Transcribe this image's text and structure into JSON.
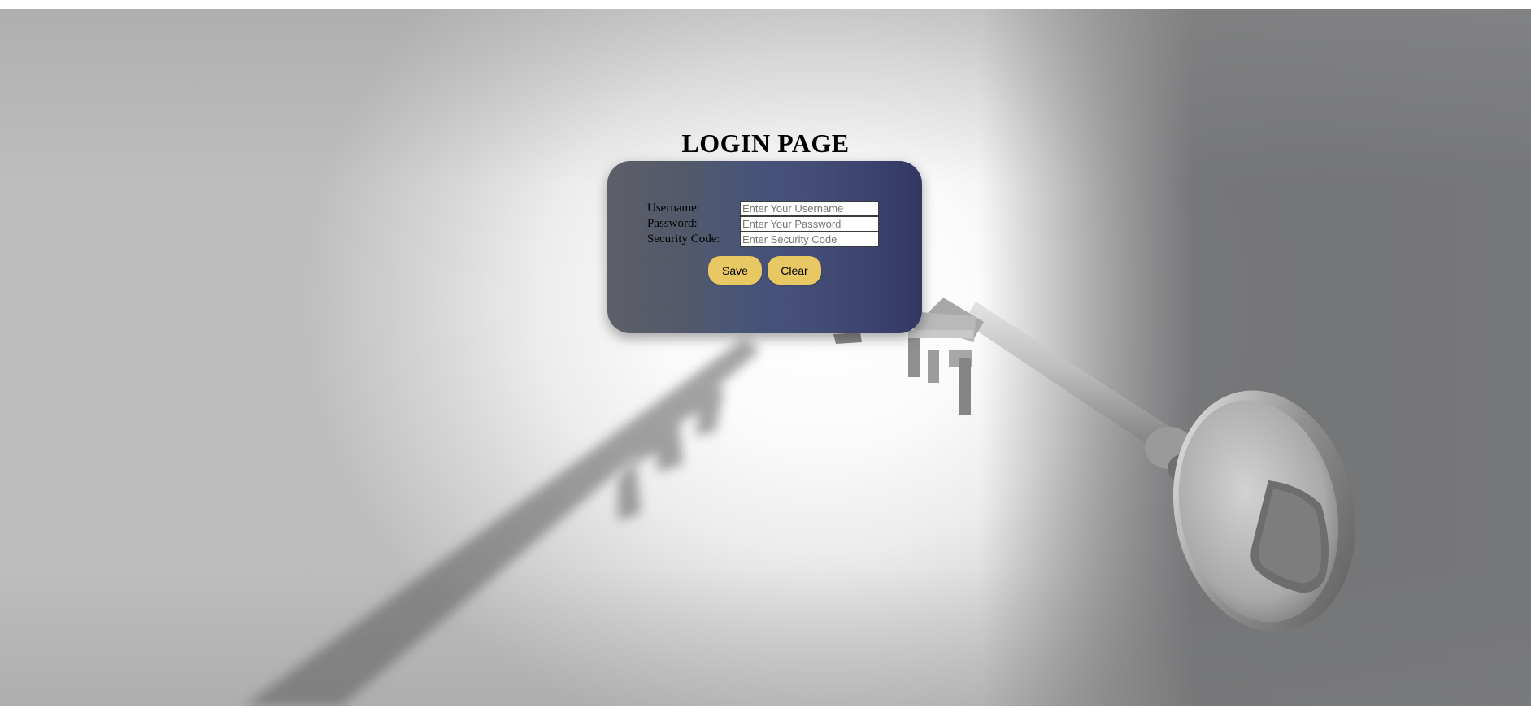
{
  "page": {
    "title": "LOGIN PAGE"
  },
  "form": {
    "username": {
      "label": "Username:",
      "placeholder": "Enter Your Username",
      "value": ""
    },
    "password": {
      "label": "Password:",
      "placeholder": "Enter Your Password",
      "value": ""
    },
    "security_code": {
      "label": "Security Code:",
      "placeholder": "Enter Security Code",
      "value": ""
    }
  },
  "buttons": {
    "save_label": "Save",
    "clear_label": "Clear"
  },
  "colors": {
    "card_left": "#5d5f68",
    "card_right": "#323862",
    "button_bg": "#e8c862"
  },
  "background": {
    "image_subject": "silver-key-with-shadow"
  }
}
